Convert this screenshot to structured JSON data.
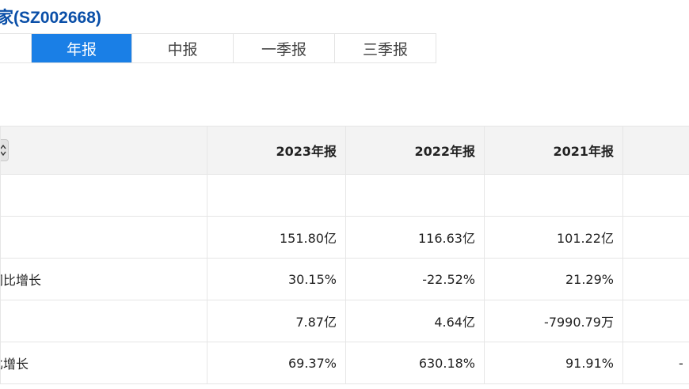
{
  "header": {
    "stock_title": "家(SZ002668)"
  },
  "tabs": [
    {
      "label": "",
      "active": false
    },
    {
      "label": "年报",
      "active": true
    },
    {
      "label": "中报",
      "active": false
    },
    {
      "label": "一季报",
      "active": false
    },
    {
      "label": "三季报",
      "active": false
    }
  ],
  "table": {
    "columns": [
      "",
      "2023年报",
      "2022年报",
      "2021年报",
      ""
    ],
    "rows": [
      {
        "label": "",
        "values": [
          "",
          "",
          "",
          ""
        ]
      },
      {
        "label": "",
        "values": [
          "151.80亿",
          "116.63亿",
          "101.22亿",
          ""
        ]
      },
      {
        "label": "同比增长",
        "values": [
          "30.15%",
          "-22.52%",
          "21.29%",
          ""
        ]
      },
      {
        "label": "",
        "values": [
          "7.87亿",
          "4.64亿",
          "-7990.79万",
          ""
        ]
      },
      {
        "label": "比增长",
        "values": [
          "69.37%",
          "630.18%",
          "91.91%",
          "-"
        ]
      }
    ]
  },
  "icons": {
    "sort_toggle": "sort-arrows-icon"
  },
  "colors": {
    "title": "#0a4fa8",
    "tab_active_bg": "#1a7fe6",
    "header_bg": "#f3f3f3",
    "border": "#e6e6e6"
  }
}
